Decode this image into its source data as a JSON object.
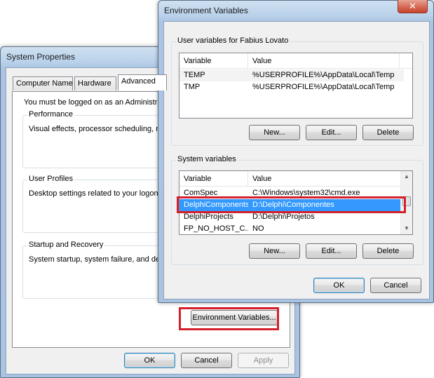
{
  "system_properties": {
    "title": "System Properties",
    "tabs": [
      {
        "label": "Computer Name"
      },
      {
        "label": "Hardware"
      },
      {
        "label": "Advanced"
      }
    ],
    "admin_notice": "You must be logged on as an Administrat",
    "groups": {
      "performance": {
        "label": "Performance",
        "text": "Visual effects, processor scheduling, me"
      },
      "user_profiles": {
        "label": "User Profiles",
        "text": "Desktop settings related to your logon"
      },
      "startup_recovery": {
        "label": "Startup and Recovery",
        "text": "System startup, system failure, and debu"
      }
    },
    "env_button": "Environment Variables...",
    "buttons": {
      "ok": "OK",
      "cancel": "Cancel",
      "apply": "Apply"
    }
  },
  "environment_variables": {
    "title": "Environment Variables",
    "close_glyph": "✕",
    "user_section": {
      "label": "User variables for Fabius Lovato",
      "columns": [
        "Variable",
        "Value"
      ],
      "rows": [
        {
          "variable": "TEMP",
          "value": "%USERPROFILE%\\AppData\\Local\\Temp"
        },
        {
          "variable": "TMP",
          "value": "%USERPROFILE%\\AppData\\Local\\Temp"
        }
      ],
      "buttons": {
        "new": "New...",
        "edit": "Edit...",
        "delete": "Delete"
      }
    },
    "system_section": {
      "label": "System variables",
      "columns": [
        "Variable",
        "Value"
      ],
      "rows": [
        {
          "variable": "ComSpec",
          "value": "C:\\Windows\\system32\\cmd.exe"
        },
        {
          "variable": "DelphiComponents",
          "value": "D:\\Delphi\\Componentes"
        },
        {
          "variable": "DelphiProjects",
          "value": "D:\\Delphi\\Projetos"
        },
        {
          "variable": "FP_NO_HOST_C...",
          "value": "NO"
        }
      ],
      "selected_row": "DelphiComponents",
      "buttons": {
        "new": "New...",
        "edit": "Edit...",
        "delete": "Delete"
      }
    },
    "buttons": {
      "ok": "OK",
      "cancel": "Cancel"
    }
  },
  "colors": {
    "highlight_box": "#d4202c",
    "selection": "#3399ff"
  }
}
